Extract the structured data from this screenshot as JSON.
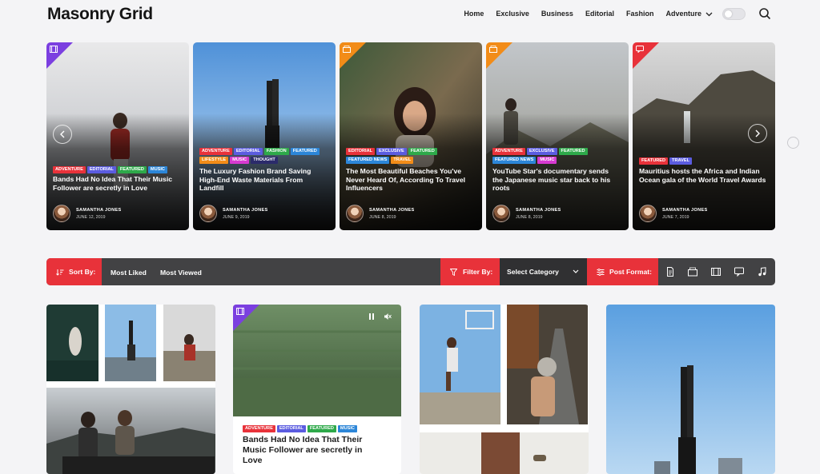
{
  "site": {
    "title": "Masonry Grid"
  },
  "nav": {
    "items": [
      "Home",
      "Exclusive",
      "Business",
      "Editorial",
      "Fashion",
      "Adventure"
    ]
  },
  "colors": {
    "adventure": "#e8323a",
    "editorial": "#5b5ce0",
    "featured": "#2ea94a",
    "music": "#2c86d8",
    "fashion": "#2ea94a",
    "lifestyle": "#f28c18",
    "thought": "#2b2b6b",
    "exclusive": "#5b5ce0",
    "featured_news": "#2c86d8",
    "travel": "#5b5ce0",
    "accent_red": "#e8323a"
  },
  "slider": {
    "cards": [
      {
        "format": "video",
        "corner_color": "#7b3fe0",
        "tags": [
          {
            "label": "Adventure",
            "color": "#e8323a"
          },
          {
            "label": "Editorial",
            "color": "#5b5ce0"
          },
          {
            "label": "Featured",
            "color": "#2ea94a"
          },
          {
            "label": "Music",
            "color": "#2c86d8"
          }
        ],
        "title": "Bands Had No Idea That Their Music Follower are secretly in Love",
        "author": "SAMANTHA JONES",
        "date": "JUNE 12, 2019"
      },
      {
        "format": "none",
        "corner_color": "",
        "tags": [
          {
            "label": "Adventure",
            "color": "#e8323a"
          },
          {
            "label": "Editorial",
            "color": "#5b5ce0"
          },
          {
            "label": "Fashion",
            "color": "#2ea94a"
          },
          {
            "label": "Featured",
            "color": "#2c86d8"
          },
          {
            "label": "Lifestyle",
            "color": "#f28c18"
          },
          {
            "label": "Music",
            "color": "#d63ad0"
          },
          {
            "label": "Thought",
            "color": "#2b2b6b"
          }
        ],
        "title": "The Luxury Fashion Brand Saving High-End Waste Materials From Landfill",
        "author": "SAMANTHA JONES",
        "date": "JUNE 9, 2019"
      },
      {
        "format": "gallery",
        "corner_color": "#f28c18",
        "tags": [
          {
            "label": "Editorial",
            "color": "#e8323a"
          },
          {
            "label": "Exclusive",
            "color": "#5b5ce0"
          },
          {
            "label": "Featured",
            "color": "#2ea94a"
          },
          {
            "label": "Featured News",
            "color": "#2c86d8"
          },
          {
            "label": "Travel",
            "color": "#f28c18"
          }
        ],
        "title": "The Most Beautiful Beaches You've Never Heard Of, According To Travel Influencers",
        "author": "SAMANTHA JONES",
        "date": "JUNE 8, 2019"
      },
      {
        "format": "gallery",
        "corner_color": "#f28c18",
        "tags": [
          {
            "label": "Adventure",
            "color": "#e8323a"
          },
          {
            "label": "Exclusive",
            "color": "#5b5ce0"
          },
          {
            "label": "Featured",
            "color": "#2ea94a"
          },
          {
            "label": "Featured News",
            "color": "#2c86d8"
          },
          {
            "label": "Music",
            "color": "#d63ad0"
          }
        ],
        "title": "YouTube Star's documentary sends the Japanese music star back to his roots",
        "author": "SAMANTHA JONES",
        "date": "JUNE 8, 2019"
      },
      {
        "format": "chat",
        "corner_color": "#e8323a",
        "tags": [
          {
            "label": "Featured",
            "color": "#e8323a"
          },
          {
            "label": "Travel",
            "color": "#5b5ce0"
          }
        ],
        "title": "Mauritius hosts the Africa and Indian Ocean gala of the World Travel Awards",
        "author": "SAMANTHA JONES",
        "date": "JUNE 7, 2019"
      }
    ],
    "prev_icon": "chevron-left-icon",
    "next_icon": "chevron-right-icon"
  },
  "filter_bar": {
    "sort_label": "Sort By:",
    "sort_options": [
      "Most Liked",
      "Most Viewed"
    ],
    "filter_label": "Filter By:",
    "category_select": "Select Category",
    "format_label": "Post Format:",
    "format_icons": [
      "document-icon",
      "gallery-icon",
      "video-icon",
      "chat-icon",
      "music-icon"
    ]
  },
  "grid": {
    "featured_post": {
      "tags": [
        {
          "label": "Adventure",
          "color": "#e8323a"
        },
        {
          "label": "Editorial",
          "color": "#5b5ce0"
        },
        {
          "label": "Featured",
          "color": "#2ea94a"
        },
        {
          "label": "Music",
          "color": "#2c86d8"
        }
      ],
      "title": "Bands Had No Idea That Their Music Follower are secretly in Love"
    }
  }
}
